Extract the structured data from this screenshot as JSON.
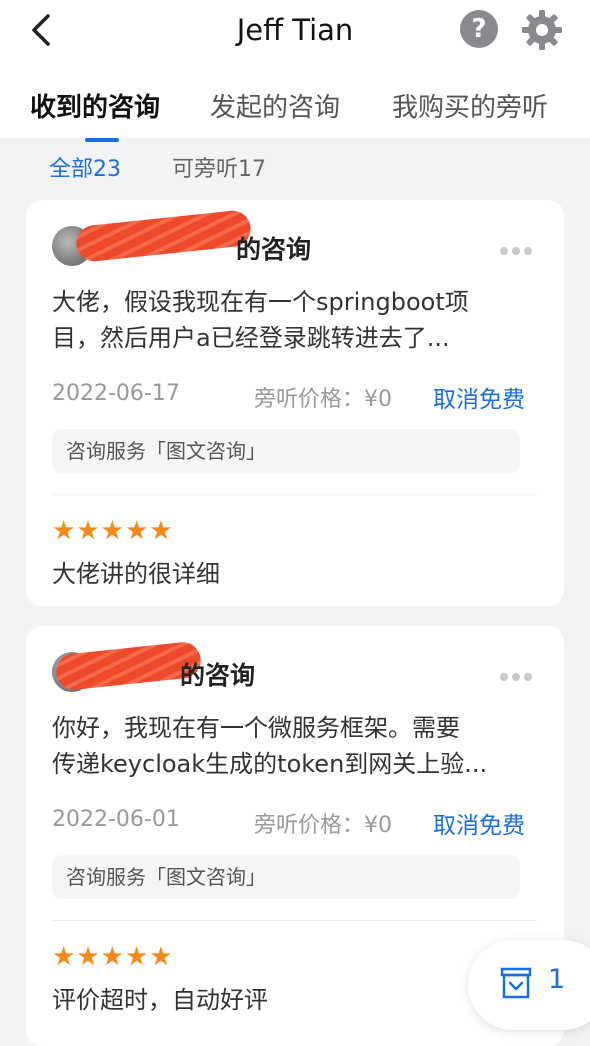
{
  "header": {
    "title": "Jeff Tian",
    "help_label": "?",
    "icons": {
      "back": "chevron-left-icon",
      "help": "question-circle-icon",
      "settings": "gear-icon"
    }
  },
  "tabs": [
    {
      "label": "收到的咨询",
      "active": true
    },
    {
      "label": "发起的咨询",
      "active": false
    },
    {
      "label": "我购买的旁听",
      "active": false
    }
  ],
  "filters": [
    {
      "label": "全部23",
      "active": true
    },
    {
      "label": "可旁听17",
      "active": false
    }
  ],
  "cards": [
    {
      "title_suffix": "的咨询",
      "question_line1": "大佬，假设我现在有一个springboot项",
      "question_line2": "目，然后用户a已经登录跳转进去了...",
      "date": "2022-06-17",
      "price": "旁听价格：¥0",
      "action": "取消免费",
      "service": "咨询服务「图文咨询」",
      "rating": 5,
      "comment": "大佬讲的很详细"
    },
    {
      "title_suffix": "的咨询",
      "question_line1": "你好，我现在有一个微服务框架。需要",
      "question_line2": "传递keycloak生成的token到网关上验...",
      "date": "2022-06-01",
      "price": "旁听价格：¥0",
      "action": "取消免费",
      "service": "咨询服务「图文咨询」",
      "rating": 5,
      "comment": "评价超时，自动好评"
    }
  ],
  "floating": {
    "count": "1",
    "icon": "inbox-icon"
  },
  "colors": {
    "accent": "#1a6fe0",
    "star": "#f58a1a",
    "background": "#f2f3f5",
    "redaction": "#ee4a2a"
  }
}
